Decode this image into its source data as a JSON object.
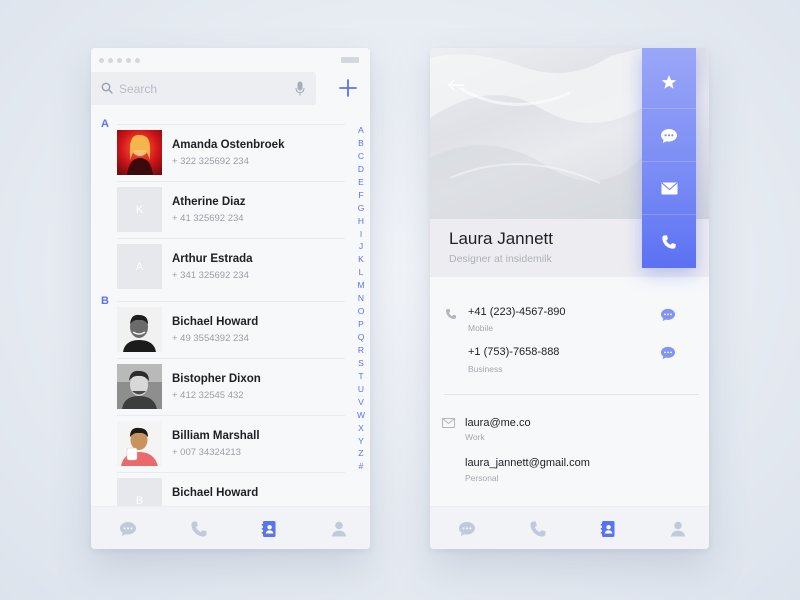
{
  "left_screen": {
    "search": {
      "placeholder": "Search"
    },
    "sections": [
      {
        "letter": "A",
        "contacts": [
          {
            "name": "Amanda Ostenbroek",
            "phone": "+ 322 325692 234",
            "avatar": "photo",
            "initial": ""
          },
          {
            "name": "Atherine Diaz",
            "phone": "+ 41 325692 234",
            "avatar": "placeholder",
            "initial": "K"
          },
          {
            "name": "Arthur Estrada",
            "phone": "+ 341 325692 234",
            "avatar": "placeholder",
            "initial": "A"
          }
        ]
      },
      {
        "letter": "B",
        "contacts": [
          {
            "name": "Bichael Howard",
            "phone": "+ 49 3554392 234",
            "avatar": "photo",
            "initial": ""
          },
          {
            "name": "Bistopher Dixon",
            "phone": "+ 412  32545 432",
            "avatar": "photo",
            "initial": ""
          },
          {
            "name": "Billiam Marshall",
            "phone": "+ 007 34324213",
            "avatar": "photo",
            "initial": ""
          },
          {
            "name": "Bichael Howard",
            "phone": "",
            "avatar": "placeholder",
            "initial": "B"
          }
        ]
      }
    ],
    "alphabet": [
      "A",
      "B",
      "C",
      "D",
      "E",
      "F",
      "G",
      "H",
      "I",
      "J",
      "K",
      "L",
      "M",
      "N",
      "O",
      "P",
      "Q",
      "R",
      "S",
      "T",
      "U",
      "V",
      "W",
      "X",
      "Y",
      "Z",
      "#"
    ],
    "tabs": [
      "chat-icon",
      "phone-icon",
      "contacts-icon",
      "profile-icon"
    ],
    "active_tab": "contacts-icon"
  },
  "right_screen": {
    "profile": {
      "name": "Laura Jannett",
      "title": "Designer at insidemilk"
    },
    "actions": [
      "star-icon",
      "chat-icon",
      "mail-icon",
      "phone-icon"
    ],
    "phones": [
      {
        "value": "+41 (223)-4567-890",
        "label": "Mobile"
      },
      {
        "value": "+1 (753)-7658-888",
        "label": "Business"
      }
    ],
    "emails": [
      {
        "value": "laura@me.co",
        "label": "Work"
      },
      {
        "value": "laura_jannett@gmail.com",
        "label": "Personal"
      }
    ],
    "tabs": [
      "chat-icon",
      "phone-icon",
      "contacts-icon",
      "profile-icon"
    ],
    "active_tab": "contacts-icon"
  },
  "colors": {
    "accent": "#5a73f0",
    "accent_light": "#9aa6f7",
    "icon_muted": "#c3c9dc",
    "background": "#e6ebf2",
    "card": "#f7f8fa"
  }
}
